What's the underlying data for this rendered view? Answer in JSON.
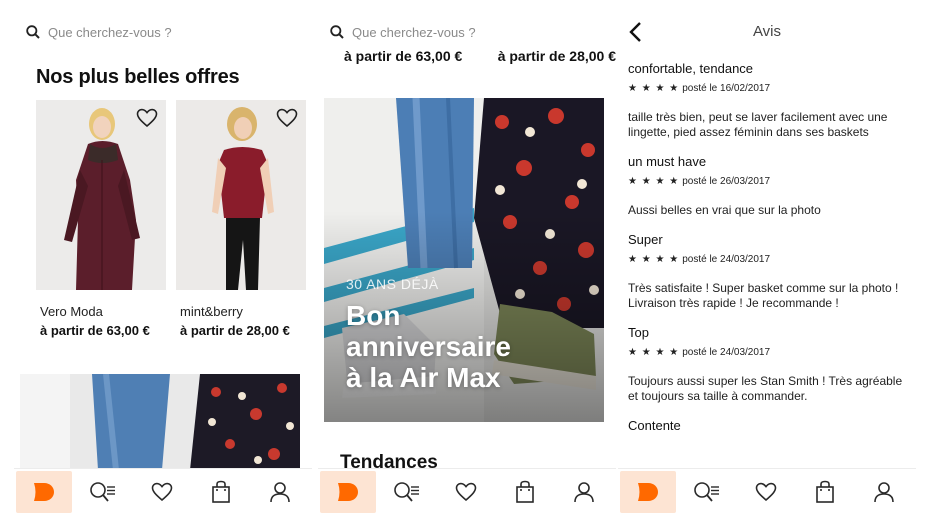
{
  "colors": {
    "accent": "#ff6900",
    "accent_bg": "#fde4d3",
    "icon": "#2a2a2a",
    "placeholder": "#8a8a8a"
  },
  "search": {
    "placeholder": "Que cherchez-vous ?",
    "icon": "search-icon"
  },
  "offers": {
    "title": "Nos plus belles offres",
    "products": [
      {
        "brand": "Vero Moda",
        "price": "à partir de 63,00 €"
      },
      {
        "brand": "mint&berry",
        "price": "à partir de 28,00 €"
      }
    ]
  },
  "promo": {
    "prices": [
      "à partir de 63,00 €",
      "à partir de 28,00 €"
    ],
    "subtitle": "30 ANS DÉJÀ",
    "title_lines": [
      "Bon",
      "anniversaire",
      "à la Air Max"
    ],
    "section": "Tendances"
  },
  "reviews": {
    "title": "Avis",
    "items": [
      {
        "title": "confortable, tendance",
        "stars": "★ ★ ★ ★",
        "posted": "posté le 16/02/2017",
        "body": "taille très bien, peut se laver facilement avec une lingette, pied assez féminin dans ses baskets"
      },
      {
        "title": "un must have",
        "stars": "★ ★ ★ ★",
        "posted": "posté le 26/03/2017",
        "body": "Aussi belles en vrai que sur la photo"
      },
      {
        "title": "Super",
        "stars": "★ ★ ★ ★",
        "posted": "posté le 24/03/2017",
        "body": "Très satisfaite ! Super basket comme sur la photo ! Livraison très rapide ! Je recommande !"
      },
      {
        "title": "Top",
        "stars": "★ ★ ★ ★",
        "posted": "posté le 24/03/2017",
        "body": "Toujours aussi super les Stan Smith ! Très agréable et toujours sa taille à commander."
      },
      {
        "title": "Contente"
      }
    ]
  },
  "tabbar": {
    "icons": [
      "home-logo-icon",
      "search-list-icon",
      "heart-icon",
      "bag-icon",
      "profile-icon"
    ]
  }
}
